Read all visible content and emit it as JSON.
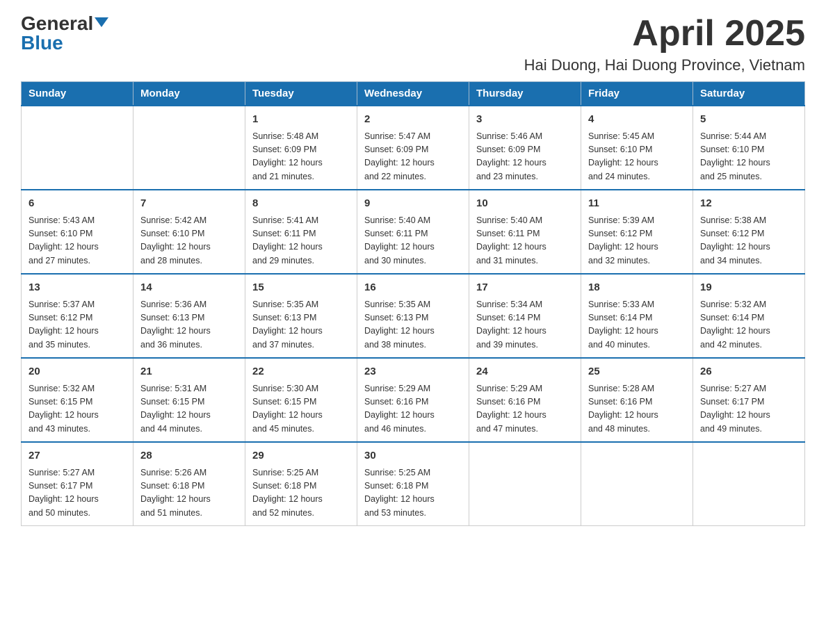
{
  "header": {
    "logo_general": "General",
    "logo_blue": "Blue",
    "month_title": "April 2025",
    "location": "Hai Duong, Hai Duong Province, Vietnam"
  },
  "weekdays": [
    "Sunday",
    "Monday",
    "Tuesday",
    "Wednesday",
    "Thursday",
    "Friday",
    "Saturday"
  ],
  "weeks": [
    [
      {
        "day": "",
        "info": ""
      },
      {
        "day": "",
        "info": ""
      },
      {
        "day": "1",
        "info": "Sunrise: 5:48 AM\nSunset: 6:09 PM\nDaylight: 12 hours\nand 21 minutes."
      },
      {
        "day": "2",
        "info": "Sunrise: 5:47 AM\nSunset: 6:09 PM\nDaylight: 12 hours\nand 22 minutes."
      },
      {
        "day": "3",
        "info": "Sunrise: 5:46 AM\nSunset: 6:09 PM\nDaylight: 12 hours\nand 23 minutes."
      },
      {
        "day": "4",
        "info": "Sunrise: 5:45 AM\nSunset: 6:10 PM\nDaylight: 12 hours\nand 24 minutes."
      },
      {
        "day": "5",
        "info": "Sunrise: 5:44 AM\nSunset: 6:10 PM\nDaylight: 12 hours\nand 25 minutes."
      }
    ],
    [
      {
        "day": "6",
        "info": "Sunrise: 5:43 AM\nSunset: 6:10 PM\nDaylight: 12 hours\nand 27 minutes."
      },
      {
        "day": "7",
        "info": "Sunrise: 5:42 AM\nSunset: 6:10 PM\nDaylight: 12 hours\nand 28 minutes."
      },
      {
        "day": "8",
        "info": "Sunrise: 5:41 AM\nSunset: 6:11 PM\nDaylight: 12 hours\nand 29 minutes."
      },
      {
        "day": "9",
        "info": "Sunrise: 5:40 AM\nSunset: 6:11 PM\nDaylight: 12 hours\nand 30 minutes."
      },
      {
        "day": "10",
        "info": "Sunrise: 5:40 AM\nSunset: 6:11 PM\nDaylight: 12 hours\nand 31 minutes."
      },
      {
        "day": "11",
        "info": "Sunrise: 5:39 AM\nSunset: 6:12 PM\nDaylight: 12 hours\nand 32 minutes."
      },
      {
        "day": "12",
        "info": "Sunrise: 5:38 AM\nSunset: 6:12 PM\nDaylight: 12 hours\nand 34 minutes."
      }
    ],
    [
      {
        "day": "13",
        "info": "Sunrise: 5:37 AM\nSunset: 6:12 PM\nDaylight: 12 hours\nand 35 minutes."
      },
      {
        "day": "14",
        "info": "Sunrise: 5:36 AM\nSunset: 6:13 PM\nDaylight: 12 hours\nand 36 minutes."
      },
      {
        "day": "15",
        "info": "Sunrise: 5:35 AM\nSunset: 6:13 PM\nDaylight: 12 hours\nand 37 minutes."
      },
      {
        "day": "16",
        "info": "Sunrise: 5:35 AM\nSunset: 6:13 PM\nDaylight: 12 hours\nand 38 minutes."
      },
      {
        "day": "17",
        "info": "Sunrise: 5:34 AM\nSunset: 6:14 PM\nDaylight: 12 hours\nand 39 minutes."
      },
      {
        "day": "18",
        "info": "Sunrise: 5:33 AM\nSunset: 6:14 PM\nDaylight: 12 hours\nand 40 minutes."
      },
      {
        "day": "19",
        "info": "Sunrise: 5:32 AM\nSunset: 6:14 PM\nDaylight: 12 hours\nand 42 minutes."
      }
    ],
    [
      {
        "day": "20",
        "info": "Sunrise: 5:32 AM\nSunset: 6:15 PM\nDaylight: 12 hours\nand 43 minutes."
      },
      {
        "day": "21",
        "info": "Sunrise: 5:31 AM\nSunset: 6:15 PM\nDaylight: 12 hours\nand 44 minutes."
      },
      {
        "day": "22",
        "info": "Sunrise: 5:30 AM\nSunset: 6:15 PM\nDaylight: 12 hours\nand 45 minutes."
      },
      {
        "day": "23",
        "info": "Sunrise: 5:29 AM\nSunset: 6:16 PM\nDaylight: 12 hours\nand 46 minutes."
      },
      {
        "day": "24",
        "info": "Sunrise: 5:29 AM\nSunset: 6:16 PM\nDaylight: 12 hours\nand 47 minutes."
      },
      {
        "day": "25",
        "info": "Sunrise: 5:28 AM\nSunset: 6:16 PM\nDaylight: 12 hours\nand 48 minutes."
      },
      {
        "day": "26",
        "info": "Sunrise: 5:27 AM\nSunset: 6:17 PM\nDaylight: 12 hours\nand 49 minutes."
      }
    ],
    [
      {
        "day": "27",
        "info": "Sunrise: 5:27 AM\nSunset: 6:17 PM\nDaylight: 12 hours\nand 50 minutes."
      },
      {
        "day": "28",
        "info": "Sunrise: 5:26 AM\nSunset: 6:18 PM\nDaylight: 12 hours\nand 51 minutes."
      },
      {
        "day": "29",
        "info": "Sunrise: 5:25 AM\nSunset: 6:18 PM\nDaylight: 12 hours\nand 52 minutes."
      },
      {
        "day": "30",
        "info": "Sunrise: 5:25 AM\nSunset: 6:18 PM\nDaylight: 12 hours\nand 53 minutes."
      },
      {
        "day": "",
        "info": ""
      },
      {
        "day": "",
        "info": ""
      },
      {
        "day": "",
        "info": ""
      }
    ]
  ]
}
